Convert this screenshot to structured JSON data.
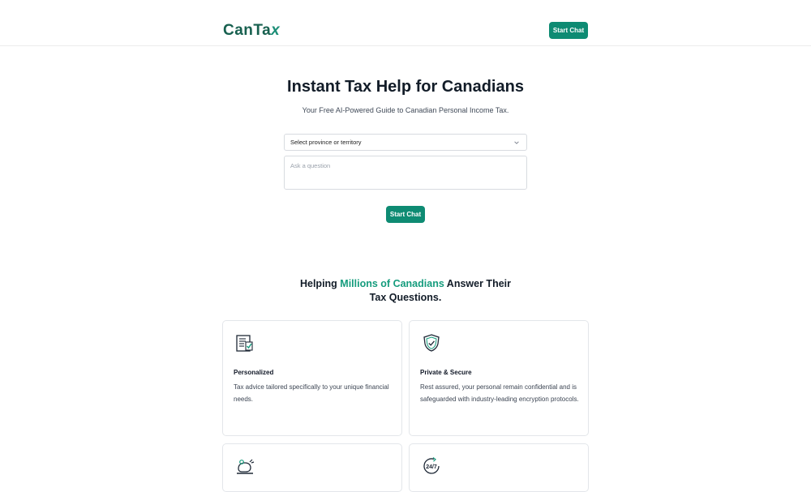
{
  "header": {
    "logo_main": "CanTa",
    "logo_x": "x",
    "cta_label": "Start Chat"
  },
  "hero": {
    "title": "Instant Tax Help for Canadians",
    "subtitle": "Your Free AI-Powered Guide to Canadian Personal Income Tax.",
    "province_select_value": "Select province or territory",
    "question_placeholder": "Ask a question",
    "cta_label": "Start Chat"
  },
  "features": {
    "title_pre": "Helping ",
    "title_highlight": "Millions of Canadians",
    "title_post": " Answer Their Tax Questions.",
    "cards": [
      {
        "icon": "document-icon",
        "title": "Personalized",
        "description": "Tax advice tailored specifically to your unique financial needs."
      },
      {
        "icon": "shield-check-icon",
        "title": "Private & Secure",
        "description": "Rest assured, your personal remain confidential and is safeguarded with industry-leading encryption protocols."
      },
      {
        "icon": "piggy-bank-icon",
        "title": "",
        "description": ""
      },
      {
        "icon": "24-7-icon",
        "icon_text": "24/7",
        "title": "",
        "description": ""
      }
    ]
  },
  "colors": {
    "accent": "#0e8b73",
    "highlight": "#159c7d",
    "logo": "#17604f"
  }
}
